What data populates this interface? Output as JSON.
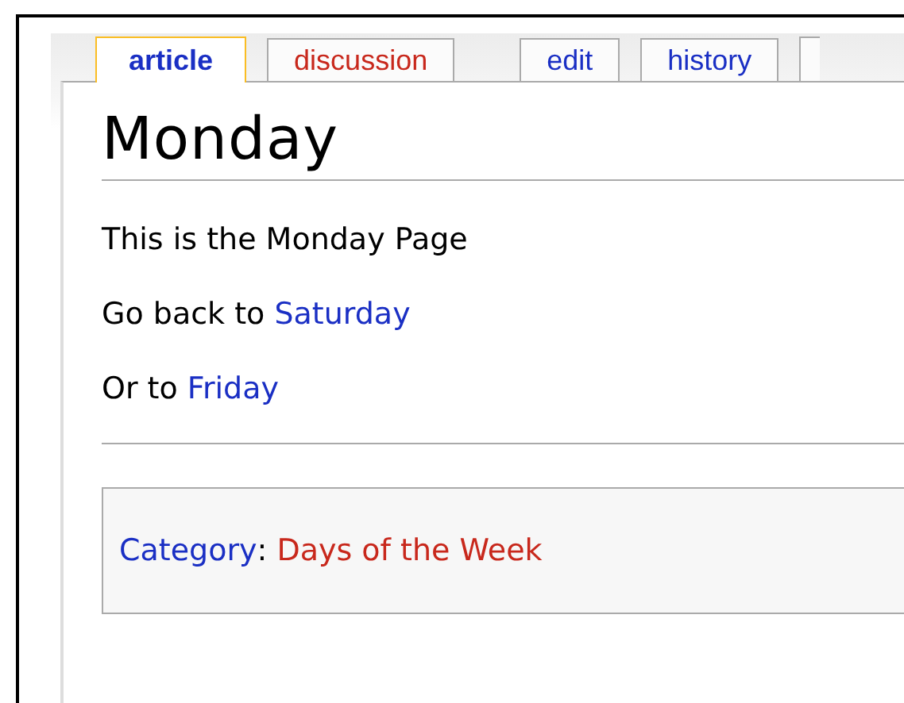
{
  "tabs": [
    {
      "label": "article",
      "selected": true,
      "kind": "existing"
    },
    {
      "label": "discussion",
      "selected": false,
      "kind": "missing"
    },
    {
      "label": "edit",
      "selected": false,
      "kind": "existing"
    },
    {
      "label": "history",
      "selected": false,
      "kind": "existing"
    }
  ],
  "title": "Monday",
  "paragraphs": [
    {
      "text": "This is the Monday Page"
    },
    {
      "text": "Go back to",
      "link": "Saturday"
    },
    {
      "text": "Or to",
      "link": "Friday"
    }
  ],
  "categories": {
    "label": "Category",
    "separator": ":",
    "items": [
      {
        "text": "Days of the Week",
        "kind": "missing"
      }
    ]
  }
}
